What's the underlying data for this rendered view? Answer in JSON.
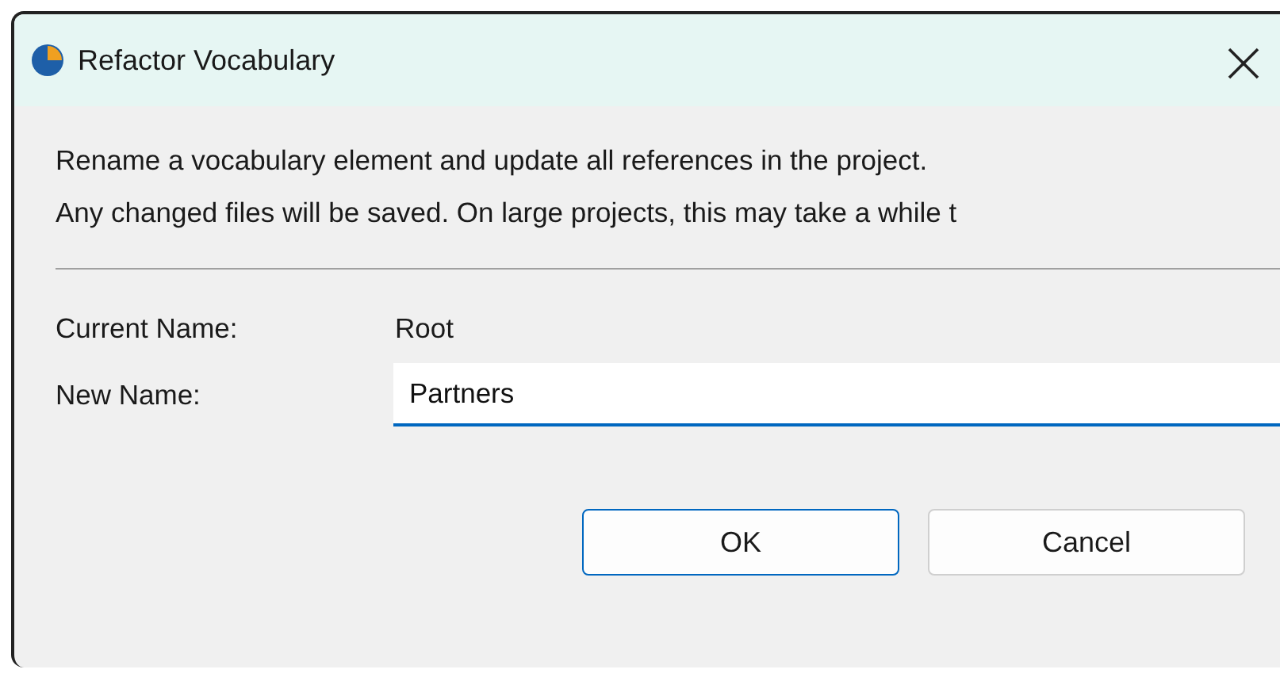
{
  "window": {
    "title": "Refactor Vocabulary"
  },
  "description": [
    "Rename a vocabulary element and update all references in the project.",
    "Any changed files will be saved. On large projects, this may take a while t"
  ],
  "fields": [
    {
      "kind": "readonly",
      "label": "Current Name:",
      "value": "Root"
    },
    {
      "kind": "input",
      "label": "New Name:",
      "value": "Partners",
      "focused": true
    }
  ],
  "buttons": [
    {
      "label": "OK",
      "default": true
    },
    {
      "label": "Cancel",
      "default": false
    }
  ]
}
